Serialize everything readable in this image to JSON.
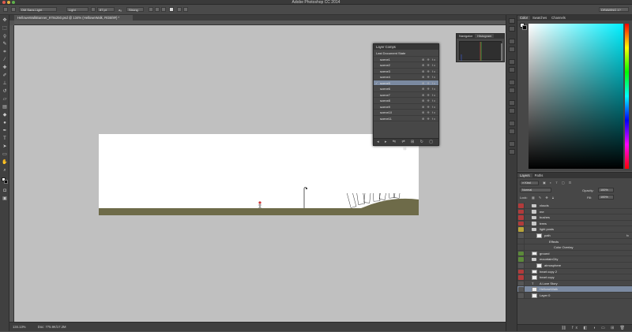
{
  "app": {
    "window_title": "Adobe Photoshop CC 2014",
    "workspace": "DRAWING 1?"
  },
  "options_bar": {
    "font_family": "DM Sans Light",
    "font_style": "Light",
    "font_size": "87 pt",
    "antialias_label": "aₐ",
    "antialias": "Strong"
  },
  "document": {
    "tab_label": "HelloweWalkBanner_978x250.psd @ 134% (HelloweWalk, RGB/8#) *",
    "zoom": "134.13%",
    "doc_size": "Doc: 775.9K/17.2M"
  },
  "layer_comps_panel": {
    "title": "Layer Comps",
    "last_state": "Last Document State",
    "comps": [
      "scene1",
      "scene2",
      "scene3",
      "scene4",
      "scene5",
      "scene6",
      "scene7",
      "scene8",
      "scene9",
      "scene10",
      "scene11"
    ],
    "selected_index": 4
  },
  "navigator_panel": {
    "tabs": [
      "Navigator",
      "Histogram"
    ],
    "active": "Histogram"
  },
  "color_panel": {
    "tabs": [
      "Color",
      "Swatches",
      "Channels"
    ],
    "active": "Color"
  },
  "layers_panel": {
    "tabs": [
      "Layers",
      "Paths"
    ],
    "filter_label": "Kind",
    "blend_mode": "Normal",
    "opacity_label": "Opacity:",
    "opacity": "100%",
    "lock_label": "Lock:",
    "fill_label": "Fill:",
    "fill": "100%",
    "layers": [
      {
        "name": "clouds",
        "type": "folder",
        "color": "#b23b3b",
        "indent": 1
      },
      {
        "name": "me",
        "type": "folder",
        "color": "#b23b3b",
        "indent": 1
      },
      {
        "name": "bushes",
        "type": "folder",
        "color": "#b23b3b",
        "indent": 1
      },
      {
        "name": "trees",
        "type": "folder",
        "color": "#b23b3b",
        "indent": 1
      },
      {
        "name": "light posts",
        "type": "folder",
        "color": "#b8a43a",
        "indent": 1
      },
      {
        "name": "path",
        "type": "shape",
        "color": "",
        "indent": 2,
        "fx": "fx"
      },
      {
        "name": "Effects",
        "type": "effect",
        "color": "",
        "indent": 3
      },
      {
        "name": "Color Overlay",
        "type": "effect",
        "color": "",
        "indent": 4
      },
      {
        "name": "ground",
        "type": "layer",
        "color": "#5c8a3a",
        "indent": 1
      },
      {
        "name": "mountainCity",
        "type": "folder",
        "color": "#5c8a3a",
        "indent": 1
      },
      {
        "name": "atmosphere",
        "type": "shape",
        "color": "",
        "indent": 2
      },
      {
        "name": "heart copy 2",
        "type": "layer",
        "color": "#b23b3b",
        "indent": 1
      },
      {
        "name": "heart copy",
        "type": "layer",
        "color": "#b23b3b",
        "indent": 1
      },
      {
        "name": "A Love Story",
        "type": "text",
        "color": "",
        "indent": 1
      },
      {
        "name": "HelloweWalk",
        "type": "layer",
        "color": "",
        "indent": 1
      },
      {
        "name": "Layer 0",
        "type": "layer",
        "color": "",
        "indent": 1
      }
    ],
    "selected_index": 14
  }
}
